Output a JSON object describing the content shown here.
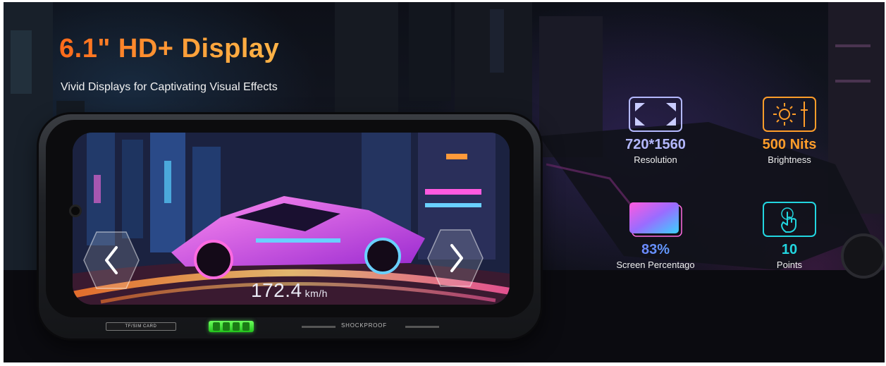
{
  "hero": {
    "headline": "6.1\" HD+ Display",
    "subheadline": "Vivid Displays for Captivating Visual Effects"
  },
  "phone": {
    "speed_value": "172.4",
    "speed_unit": "km/h",
    "slot_label": "TF/SIM CARD",
    "side_label": "SHOCKPROOF"
  },
  "specs": [
    {
      "value": "720*1560",
      "label": "Resolution",
      "icon": "resolution-frame-icon",
      "color": "#b4b8ff"
    },
    {
      "value": "500 Nits",
      "label": "Brightness",
      "icon": "brightness-sun-icon",
      "color": "#ff9d2a"
    },
    {
      "value": "83%",
      "label": "Screen Percentago",
      "icon": "screen-ratio-icon",
      "color": "#6e74ff"
    },
    {
      "value": "10",
      "label": "Points",
      "icon": "touch-hand-icon",
      "color": "#22d6e0"
    }
  ],
  "colors": {
    "headline_orange": "#ff8a1c",
    "background": "#0d1018"
  }
}
